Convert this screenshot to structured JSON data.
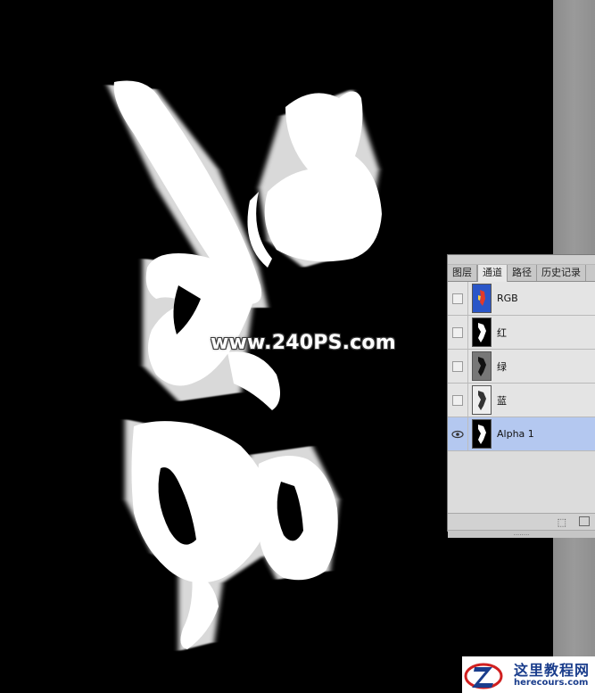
{
  "watermark": "www.240PS.com",
  "panel": {
    "tabs": [
      {
        "label": "图层",
        "active": false
      },
      {
        "label": "通道",
        "active": true
      },
      {
        "label": "路径",
        "active": false
      },
      {
        "label": "历史记录",
        "active": false
      }
    ],
    "channels": [
      {
        "name": "RGB",
        "visible": false,
        "selected": false,
        "thumb": "rgb"
      },
      {
        "name": "红",
        "visible": false,
        "selected": false,
        "thumb": "red"
      },
      {
        "name": "绿",
        "visible": false,
        "selected": false,
        "thumb": "green"
      },
      {
        "name": "蓝",
        "visible": false,
        "selected": false,
        "thumb": "blue"
      },
      {
        "name": "Alpha 1",
        "visible": true,
        "selected": true,
        "thumb": "alpha"
      }
    ],
    "footer_icons": [
      "load-channel-selection-icon",
      "save-selection-icon"
    ]
  },
  "logo": {
    "name": "这里教程网",
    "url": "herecours.com"
  },
  "colors": {
    "canvas": "#000000",
    "panel_bg": "#d6d6d6",
    "selected_row": "#b4c8f0",
    "logo_blue": "#1a3d8c"
  }
}
